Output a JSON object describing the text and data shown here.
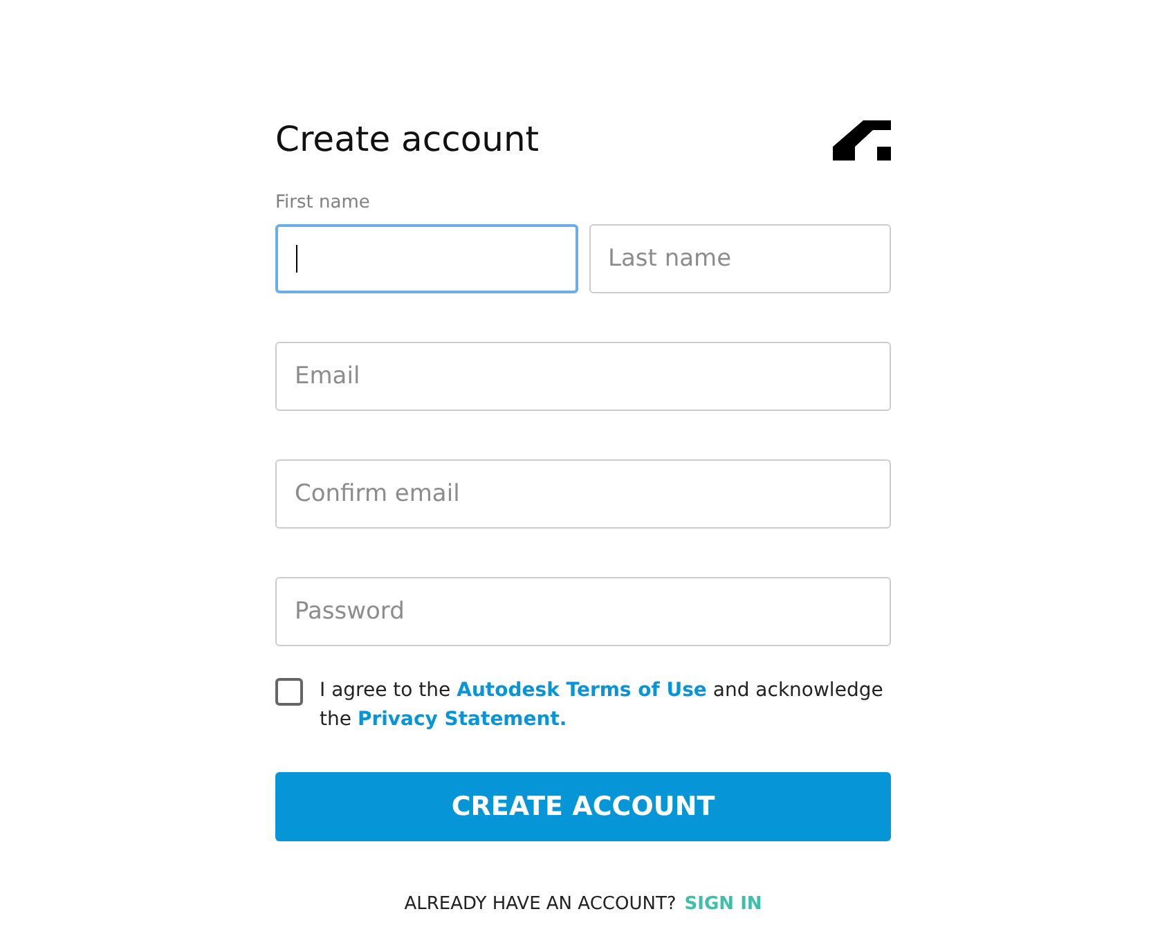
{
  "title": "Create account",
  "name_fields": [
    {
      "placeholder": "First name",
      "focused": true
    },
    {
      "placeholder": "Last name",
      "focused": false
    }
  ],
  "fields": [
    {
      "placeholder": "Email",
      "focused": false
    },
    {
      "placeholder": "Confirm email",
      "focused": false
    },
    {
      "placeholder": "Password",
      "focused": false
    }
  ],
  "agreement": {
    "checked": false,
    "parts": [
      {
        "kind": "text",
        "text": "I agree to the"
      },
      {
        "kind": "link",
        "text": "Autodesk Terms of Use"
      },
      {
        "kind": "text",
        "text": "and acknowledge the"
      },
      {
        "kind": "link",
        "text": "Privacy Statement."
      }
    ]
  },
  "submit_button": "CREATE ACCOUNT",
  "sign_in": {
    "prompt": "ALREADY HAVE AN ACCOUNT?",
    "link": "SIGN IN"
  }
}
